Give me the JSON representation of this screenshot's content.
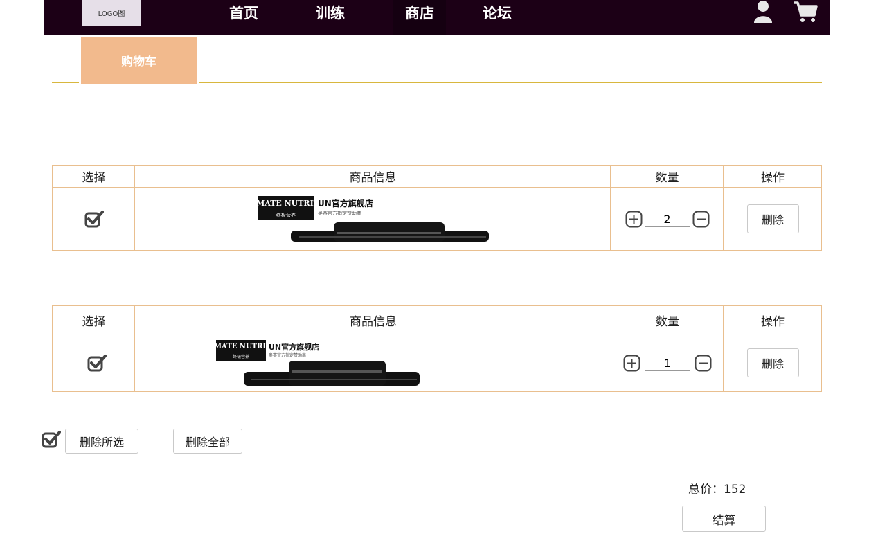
{
  "navbar": {
    "logo": "LOGO图",
    "items": [
      "首页",
      "训练",
      "商店",
      "论坛"
    ],
    "active": "商店",
    "icons": [
      "user-icon",
      "cart-icon"
    ]
  },
  "tab": {
    "label": "购物车",
    "color": "#f2ba8d"
  },
  "table_headers": {
    "select": "选择",
    "product": "商品信息",
    "quantity": "数量",
    "action": "操作"
  },
  "items": [
    {
      "checked": true,
      "brand_logo": "ULTIMATE NUTRITION",
      "store": "UN官方旗舰店",
      "subtitle": "奥赛官方指定赞助商",
      "brand_cn": "终极营养",
      "quantity": "2",
      "delete_label": "删除"
    },
    {
      "checked": true,
      "brand_logo": "ULTIMATE NUTRITION",
      "store": "UN官方旗舰店",
      "subtitle": "奥赛官方指定赞助商",
      "brand_cn": "终极营养",
      "quantity": "1",
      "delete_label": "删除"
    }
  ],
  "footer": {
    "select_all_checked": true,
    "delete_selected": "删除所选",
    "delete_all": "删除全部",
    "total_label": "总价：152",
    "checkout": "结算"
  },
  "colors": {
    "nav_bg": "#1c0016",
    "tab_bg": "#f2ba8d",
    "table_border": "#e9bf8f",
    "tab_line": "#d8b73e"
  }
}
